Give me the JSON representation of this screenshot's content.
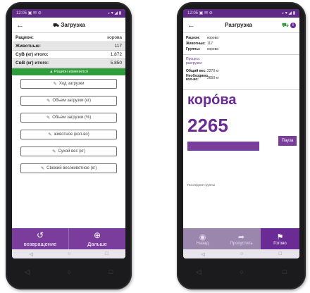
{
  "left": {
    "status": {
      "left": "12:05 ▣ ✉ ⊘",
      "right": "◒ ▾ ◢ ▮"
    },
    "title": "Загрузка",
    "info": [
      {
        "label": "Рацион:",
        "value": "корова"
      },
      {
        "label": "Животные:",
        "value": "117"
      },
      {
        "label": "СуВ (кг) итого:",
        "value": "1.872"
      },
      {
        "label": "СвВ (кг) итого:",
        "value": "5.850"
      }
    ],
    "notice": "Рацион изменился",
    "buttons": [
      "Ход загрузки",
      "Объем загрузки (кг)",
      "Объем загрузки (%)",
      "животное (кол-во)",
      "Сухой вес (кг)",
      "Свежий вес/животное (кг)"
    ],
    "bottom": {
      "back_label": "возвращение",
      "next_label": "Дальше"
    },
    "nav": [
      "◁",
      "○",
      "□"
    ],
    "softkeys": [
      "◁",
      "○",
      "□"
    ]
  },
  "right": {
    "status": {
      "left": "12:05 ▣ ✉ ⊘",
      "right": "◒ ▾ ◢ ▮"
    },
    "title": "Разгрузка",
    "info": [
      {
        "label": "Рацион:",
        "value": "корова"
      },
      {
        "label": "Животные:",
        "value": "117"
      },
      {
        "label": "Группы:",
        "value": "корова"
      }
    ],
    "section": "Процесс разгрузки",
    "info2": [
      {
        "label": "Общий вес:",
        "value": "2270 кг"
      },
      {
        "label": "Необходимо кол-во:",
        "value": "2650 кг"
      }
    ],
    "big_name": "коро́ва",
    "big_number": "2265",
    "pause_label": "Пауза",
    "progress_value": 0.6,
    "footnote": "Последние группы",
    "bottom": {
      "back_label": "Назад",
      "skip_label": "Пропустить",
      "done_label": "Готово"
    },
    "nav": [
      "◁",
      "○",
      "□"
    ],
    "softkeys": [
      "◁",
      "○",
      "□"
    ]
  }
}
